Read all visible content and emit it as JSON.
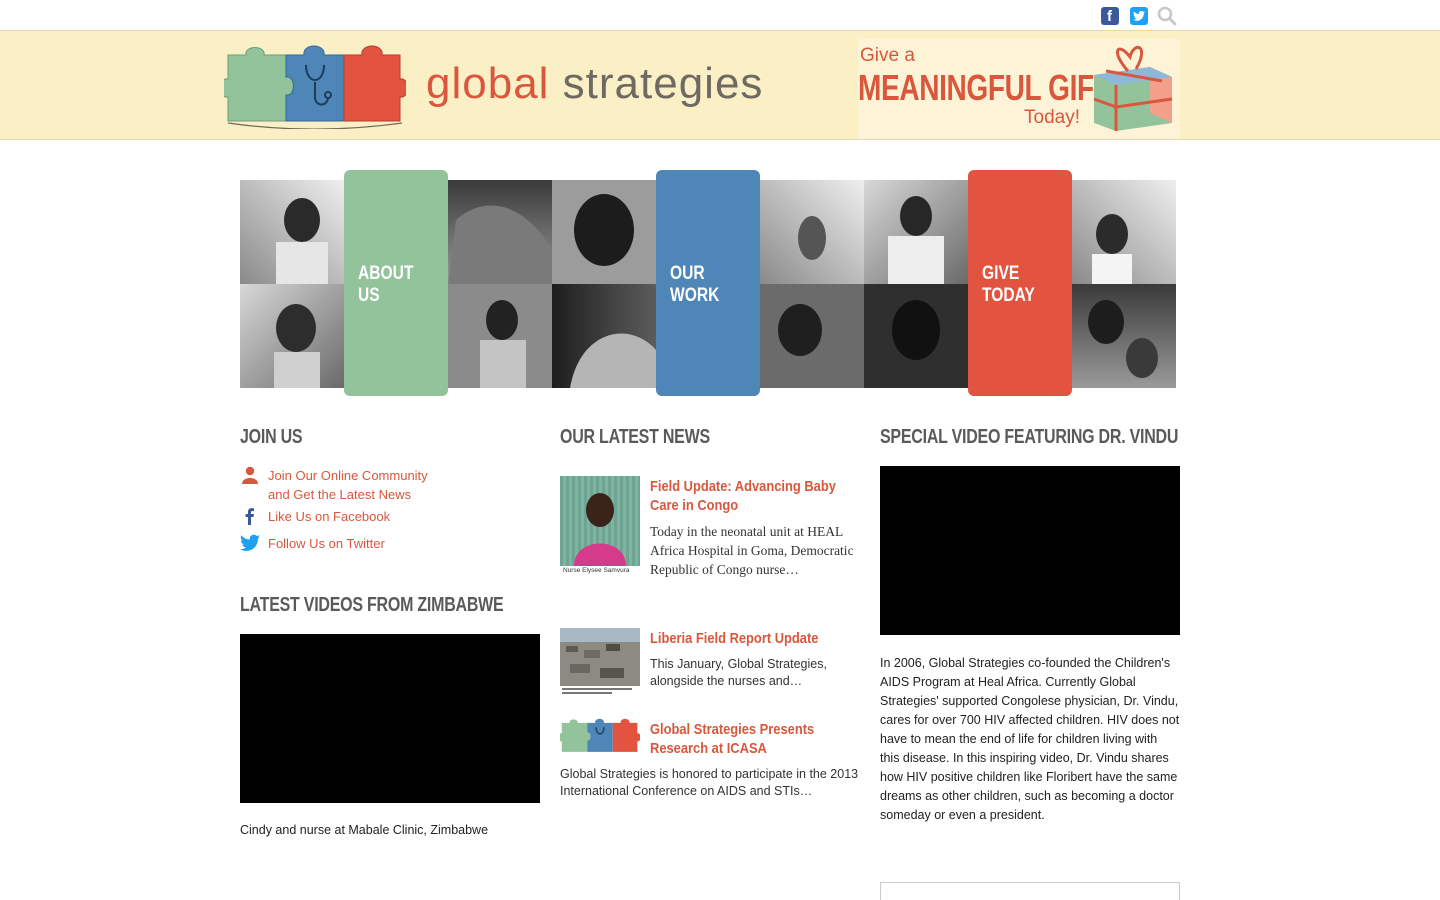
{
  "top_bar": {
    "facebook_icon": "facebook-icon",
    "twitter_icon": "twitter-icon",
    "search_icon": "search-icon"
  },
  "header": {
    "logo_word_1": "global",
    "logo_word_2": "strategies",
    "gift_line_1": "Give a",
    "gift_line_2": "MEANINGFUL GIFT",
    "gift_line_3": "Today!"
  },
  "hero_nav": [
    {
      "label": "ABOUT\nUS",
      "color": "#93c39b"
    },
    {
      "label": "OUR\nWORK",
      "color": "#4f86b8"
    },
    {
      "label": "GIVE\nTODAY",
      "color": "#e25440"
    }
  ],
  "join_us": {
    "heading": "JOIN US",
    "links": [
      {
        "icon": "person-icon",
        "text": "Join Our Online Community and Get the Latest News"
      },
      {
        "icon": "facebook-icon",
        "text": "Like Us on Facebook"
      },
      {
        "icon": "twitter-icon",
        "text": "Follow Us on Twitter"
      }
    ]
  },
  "latest_videos": {
    "heading": "LATEST VIDEOS FROM ZIMBABWE",
    "caption": "Cindy and nurse at Mabale Clinic, Zimbabwe"
  },
  "news": {
    "heading": "OUR LATEST NEWS",
    "items": [
      {
        "title": "Field Update: Advancing Baby Care in Congo",
        "excerpt": " Today in the neonatal unit at HEAL Africa Hospital in Goma, Democratic Republic of Congo nurse…",
        "thumb_caption": "Nurse Elysee Samvura"
      },
      {
        "title": "Liberia Field Report Update",
        "excerpt": "This January, Global Strategies, alongside the nurses and…"
      },
      {
        "title": "Global Strategies Presents Research at ICASA",
        "excerpt": "Global Strategies is honored to participate in the 2013 International Conference on AIDS and STIs…"
      }
    ]
  },
  "special_video": {
    "heading": "SPECIAL VIDEO FEATURING DR. VINDU",
    "description": "In 2006, Global Strategies co-founded the Children's AIDS Program at Heal Africa. Currently Global Strategies' supported Congolese physician, Dr. Vindu, cares for over 700 HIV affected children. HIV does not have to mean the end of life for children living with this disease. In this inspiring video, Dr. Vindu shares how HIV positive children like Floribert have the same dreams as other children, such as becoming a doctor someday or even a president."
  },
  "colors": {
    "accent_red": "#d9573d",
    "banner_bg": "#fbefc6",
    "green": "#93c39b",
    "blue": "#4f86b8",
    "red": "#e25440"
  }
}
